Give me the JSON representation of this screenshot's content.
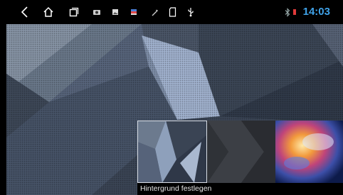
{
  "statusbar": {
    "icons": [
      "back-icon",
      "home-icon",
      "recent-apps-icon",
      "camera-icon",
      "screenshot-icon",
      "flag-icon",
      "wrench-icon",
      "sd-card-icon",
      "usb-icon",
      "bluetooth-icon",
      "battery-icon"
    ],
    "time": "14:03",
    "accent": "#3fa2e8"
  },
  "wallpaper": {
    "caption": "Hintergrund festlegen",
    "thumbnails": [
      "geometric-blue",
      "dark-chevron",
      "colorful-nebula"
    ]
  }
}
